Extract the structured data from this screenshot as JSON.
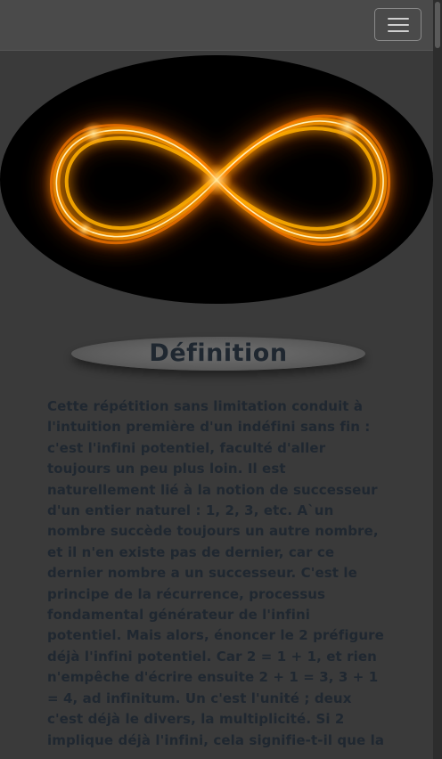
{
  "navbar": {
    "toggle_icon": "hamburger-icon"
  },
  "hero": {
    "image": "glowing-infinity-symbol",
    "colors": {
      "background": "#000000",
      "glow_core": "#fff4c0",
      "glow_mid": "#ffb000",
      "glow_outer": "#c84a00"
    }
  },
  "section": {
    "title": "Définition",
    "paragraph": "Cette répétition sans limitation conduit à l'intuition première d'un indéfini sans fin : c'est l'infini potentiel, faculté d'aller toujours un peu plus loin. Il est naturellement lié à la notion de successeur d'un entier naturel : 1, 2, 3, etc. A`un nombre succède toujours un autre nombre, et il n'en existe pas de dernier, car ce dernier nombre a un successeur. C'est le principe de la récurrence, processus fondamental générateur de l'infini potentiel. Mais alors, énoncer le 2 préfigure déjà l'infini potentiel. Car 2 = 1 + 1, et rien n'empêche d'écrire ensuite 2 + 1 = 3, 3 + 1 = 4, ad infinitum. Un c'est l'unité ; deux c'est déjà le divers, la multiplicité. Si 2 implique déjà l'infini, cela signifie-t-il que la"
  }
}
